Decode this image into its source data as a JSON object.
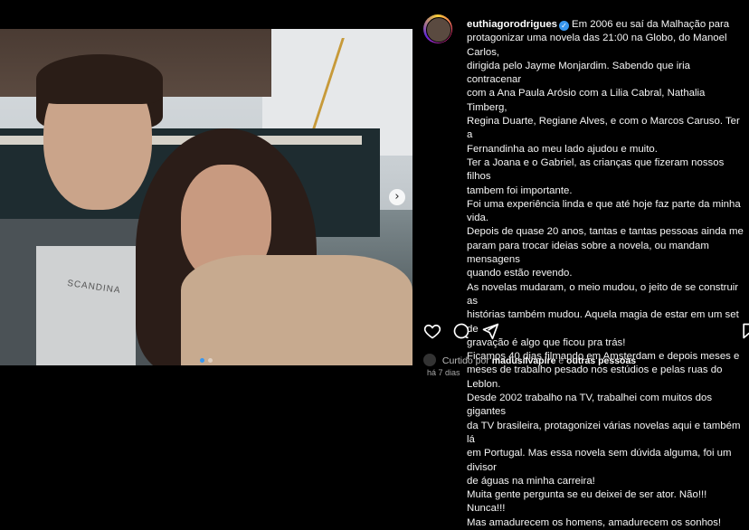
{
  "post": {
    "username": "euthiagorodrigues",
    "verified": true,
    "caption_lines": [
      "Em 2006 eu saí da Malhação para",
      "protagonizar uma novela das 21:00 na Globo, do Manoel Carlos,",
      "dirigida pelo Jayme Monjardim. Sabendo que iria contracenar",
      "com a Ana Paula Arósio com a Lilia Cabral, Nathalia Timberg,",
      "Regina Duarte, Regiane Alves, e com o Marcos Caruso. Ter a",
      "Fernandinha ao meu lado ajudou e muito.",
      "Ter a Joana e o Gabriel, as crianças que fizeram nossos filhos",
      "tambem foi importante.",
      "Foi uma experiência linda e que até hoje faz parte da minha vida.",
      "Depois de quase 20 anos, tantas e tantas pessoas ainda me",
      "param para trocar ideias sobre a novela, ou mandam mensagens",
      "quando estão revendo.",
      "As novelas mudaram, o meio mudou, o jeito de se construir as",
      "histórias também mudou. Aquela magia de estar em um set de",
      "gravação é algo que ficou pra trás!",
      "Ficamos 40 dias filmando em Amsterdam e depois meses e",
      "meses de trabalho pesado nos estúdios e pelas ruas do Leblon.",
      "Desde 2002 trabalho na TV, trabalhei com muitos dos gigantes",
      "da TV brasileira, protagonizei várias novelas aqui e também lá",
      "em Portugal. Mas essa novela sem dúvida alguma, foi um divisor",
      "de águas na minha carreira!",
      "Muita gente pergunta se eu deixei de ser ator. Não!!! Nunca!!!",
      "Mas amadurecem os homens, amadurecem os sonhos!"
    ],
    "liked_prefix": "Curtido por",
    "liked_user": "madusilvapire",
    "liked_joiner": "e",
    "liked_others": "outras pessoas",
    "time_ago": "há 7 dias"
  },
  "photo": {
    "shirt_text": "SCANDINA",
    "carousel_count": 2,
    "carousel_active": 1
  },
  "icons": [
    "heart-icon",
    "comment-icon",
    "share-icon",
    "save-icon",
    "verified-icon",
    "next-arrow-icon"
  ],
  "colors": {
    "background": "#000000",
    "accent": "#3897f0",
    "text": "#f5f5f5",
    "muted": "#a8a8a8"
  }
}
